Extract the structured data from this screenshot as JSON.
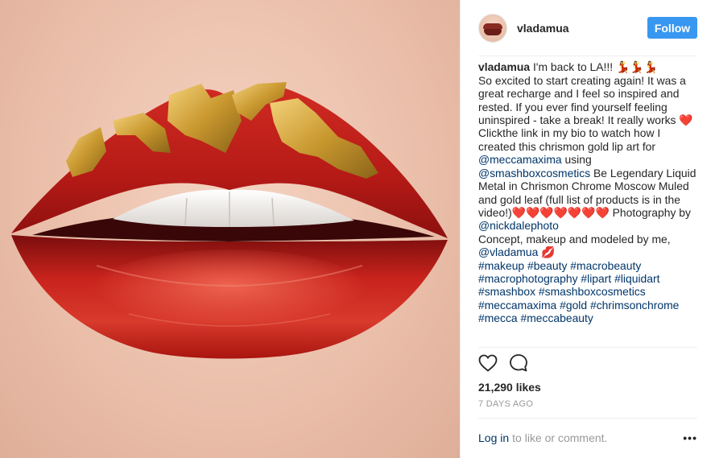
{
  "post": {
    "username": "vladamua",
    "follow_label": "Follow",
    "caption": {
      "author": "vladamua",
      "line1": " I'm back to LA!!! 💃💃💃",
      "line2": "So excited to start creating again! It was a great recharge and I feel so inspired and rested. If you ever find yourself feeling uninspired - take a break! It really works ",
      "heart1": "❤️",
      "line3": "Clickthe link in my bio to watch how I created this chrismon gold lip art for ",
      "mention1": "@meccamaxima",
      "using": " using",
      "mention2": "@smashboxcosmetics",
      "line4": " Be Legendary Liquid Metal in Chrismon Chrome Moscow Muled and gold leaf (full list of products is in the video!)",
      "hearts": "❤️❤️❤️❤️❤️❤️❤️",
      "photography": " Photography by ",
      "mention3": "@nickdalephoto",
      "line5": "Concept, makeup and modeled by me, ",
      "mention4": "@vladamua",
      "kiss": " 💋",
      "hashtags": "#makeup #beauty #macrobeauty #macrophotography #lipart #liquidart #smashbox #smashboxcosmetics #meccamaxima #gold #chrimsonchrome #mecca #meccabeauty"
    },
    "likes": "21,290 likes",
    "time": "7 DAYS AGO",
    "login_label": "Log in",
    "login_suffix": " to like or comment.",
    "more_label": "•••"
  },
  "icons": {
    "like": "heart-outline-icon",
    "comment": "comment-bubble-icon"
  },
  "colors": {
    "follow_button": "#3897f0",
    "link": "#003569",
    "lipstick": "#c0201c",
    "gold_leaf": "#d4a94a"
  }
}
